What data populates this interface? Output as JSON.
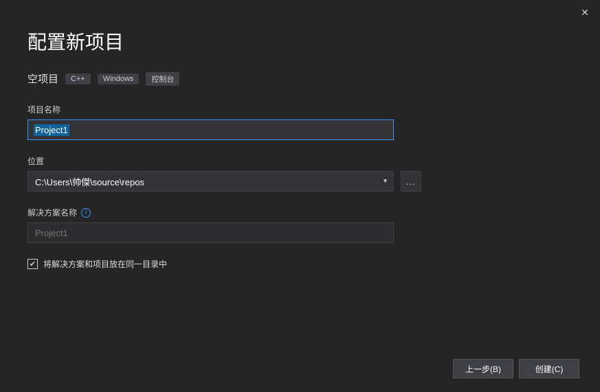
{
  "window": {
    "close_icon": "✕"
  },
  "header": {
    "title": "配置新项目",
    "subtitle": "空项目",
    "tags": [
      "C++",
      "Windows",
      "控制台"
    ]
  },
  "fields": {
    "project_name": {
      "label": "项目名称",
      "value": "Project1"
    },
    "location": {
      "label": "位置",
      "value": "C:\\Users\\帅傑\\source\\repos",
      "browse_label": "..."
    },
    "solution_name": {
      "label": "解决方案名称",
      "info_tooltip": "i",
      "placeholder": "Project1"
    },
    "same_dir_checkbox": {
      "label": "将解决方案和项目放在同一目录中",
      "checked": true
    }
  },
  "footer": {
    "back_label": "上一步(B)",
    "create_label": "创建(C)"
  }
}
